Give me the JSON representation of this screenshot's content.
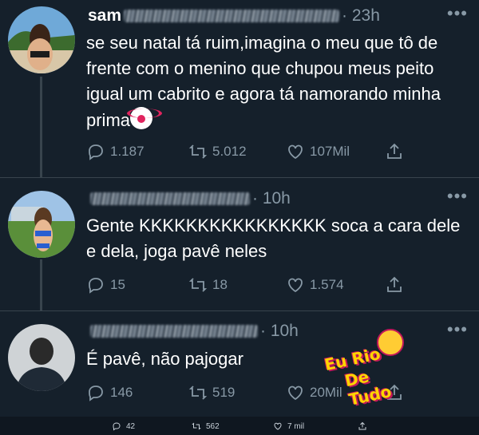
{
  "colors": {
    "bg": "#15202b",
    "muted": "#8899a6",
    "line": "#38444d",
    "text": "#ffffff"
  },
  "tweets": [
    {
      "name": "sam",
      "time": "· 23h",
      "text": "se seu natal tá ruim,imagina o meu que tô de frente com o menino que chupou meus peito igual um cabrito e agora tá namorando minha prima",
      "emoji": "clown-face",
      "replies": "1.187",
      "retweets": "5.012",
      "likes": "107Mil"
    },
    {
      "name": "",
      "time": "· 10h",
      "text": "Gente KKKKKKKKKKKKKKKK soca a cara dele e dela, joga pavê neles",
      "replies": "15",
      "retweets": "18",
      "likes": "1.574"
    },
    {
      "name": "",
      "time": "· 10h",
      "text": "É pavê, não pajogar",
      "replies": "146",
      "retweets": "519",
      "likes": "20Mil"
    }
  ],
  "watermark": {
    "line1": "Eu Rio",
    "line2": "De Tudo"
  },
  "footer": {
    "replies": "42",
    "retweets": "562",
    "likes": "7 mil"
  }
}
